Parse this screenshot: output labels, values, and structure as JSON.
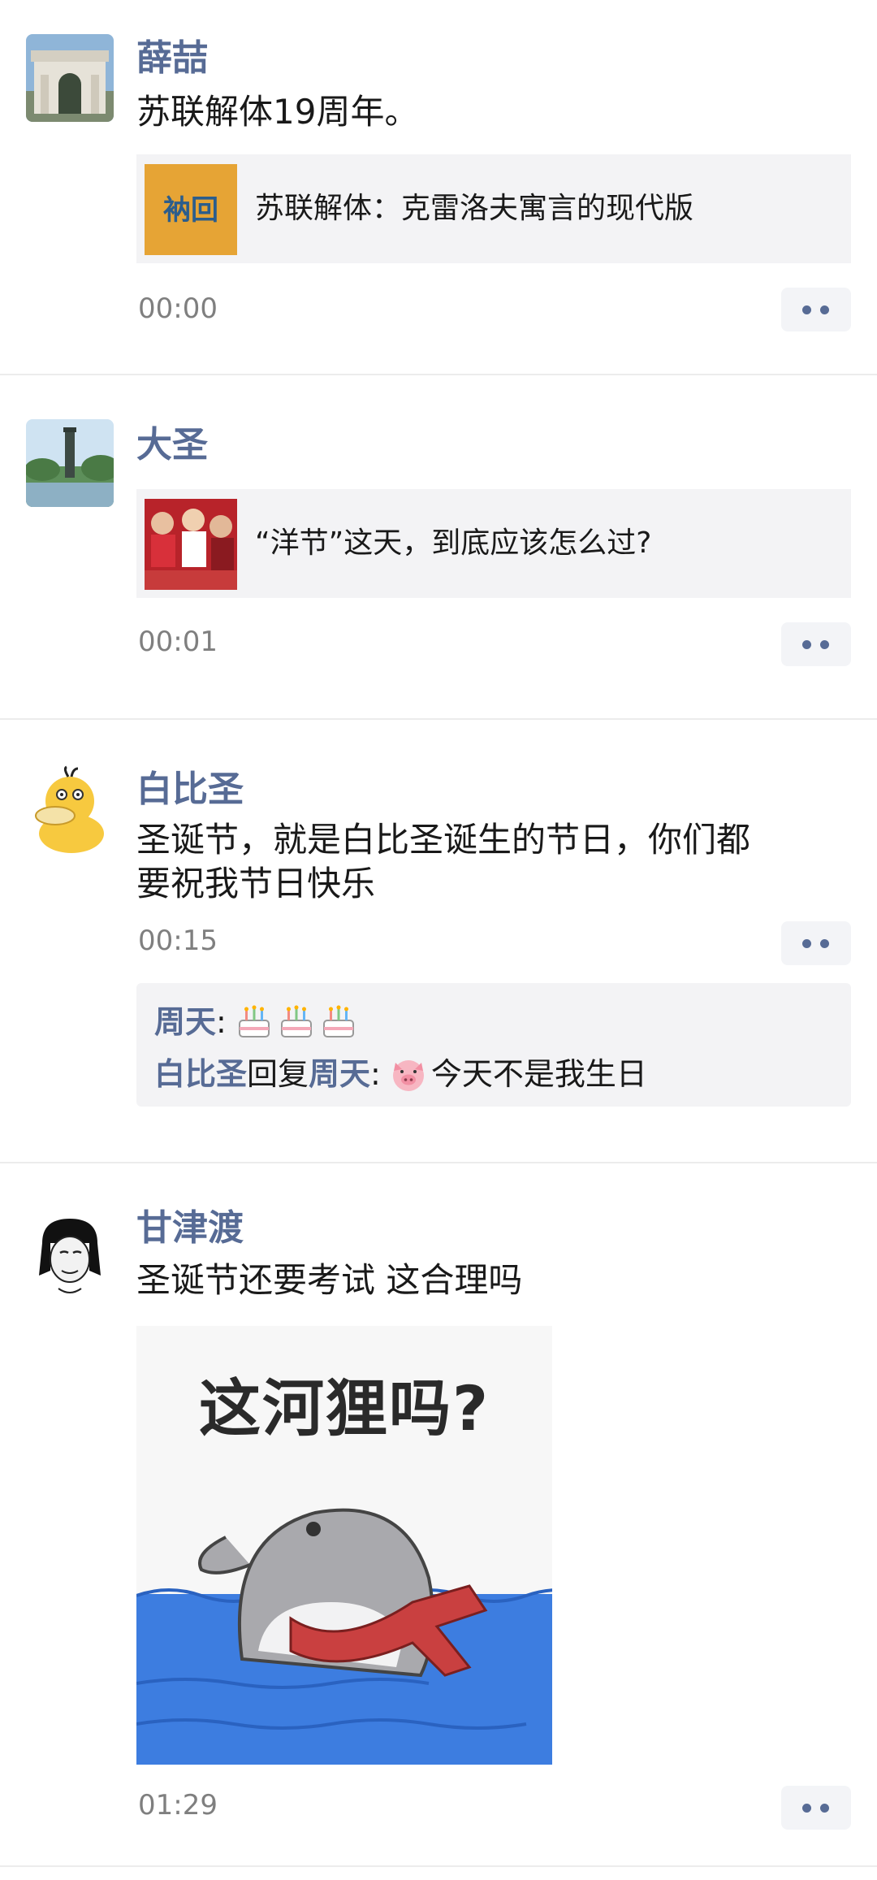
{
  "posts": [
    {
      "author": "薛喆",
      "text": "苏联解体19周年。",
      "link": {
        "title": "苏联解体：克雷洛夫寓言的现代版",
        "thumb_text": "衲回"
      },
      "time": "00:00"
    },
    {
      "author": "大圣",
      "link": {
        "title": "“洋节”这天，到底应该怎么过?"
      },
      "time": "00:01"
    },
    {
      "author": "白比圣",
      "text_line1": "圣诞节，就是白比圣诞生的节日，你们都",
      "text_line2": "要祝我节日快乐",
      "time": "00:15",
      "comments": [
        {
          "user": "周天",
          "sep": ":",
          "emoji": [
            "cake-icon",
            "cake-icon",
            "cake-icon"
          ]
        },
        {
          "user": "白比圣",
          "reply_word": "回复",
          "reply_to": "周天",
          "sep": ":",
          "emoji": [
            "pig-face-icon"
          ],
          "text": "今天不是我生日"
        }
      ]
    },
    {
      "author": "甘津渡",
      "text": "圣诞节还要考试 这合理吗",
      "meme_text": "这河狸吗?",
      "time": "01:29"
    }
  ],
  "colors": {
    "name": "#576b95",
    "time": "#7f7f7f",
    "card_bg": "#f3f3f5",
    "separator": "#ececec"
  },
  "icons": {
    "more": "two-dots-more-icon"
  }
}
